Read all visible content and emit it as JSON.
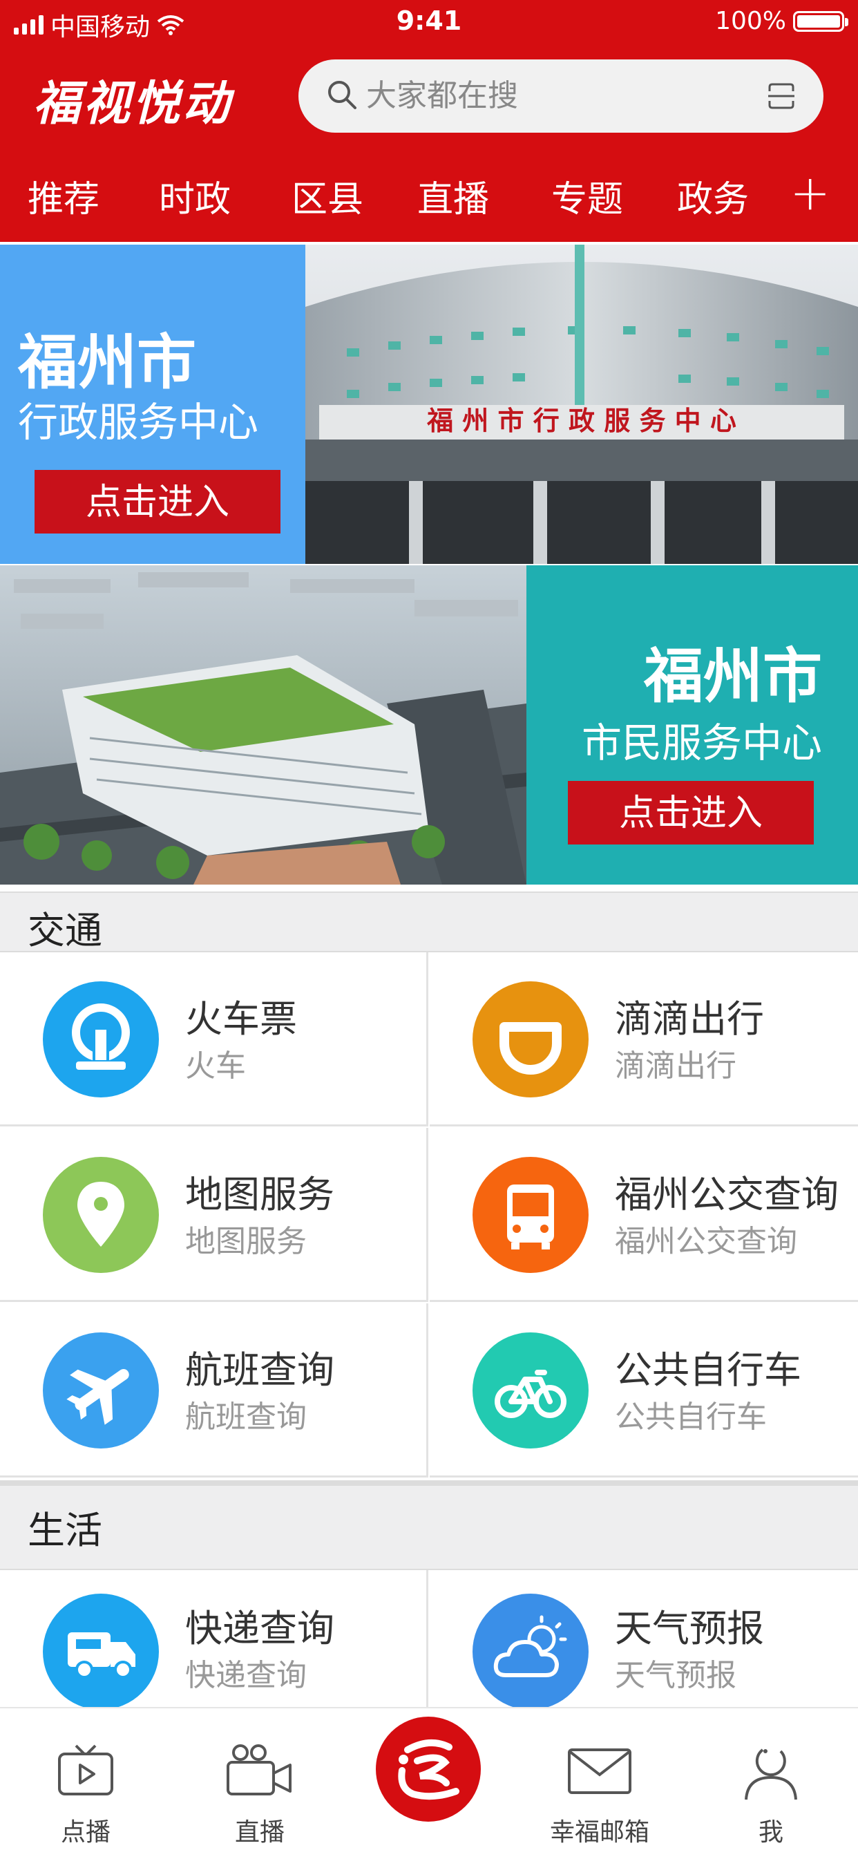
{
  "status_bar": {
    "carrier": "中国移动",
    "time": "9:41",
    "battery": "100%"
  },
  "header": {
    "logo": "福视悦动",
    "search_placeholder": "大家都在搜",
    "tabs": [
      "推荐",
      "时政",
      "区县",
      "直播",
      "专题",
      "政务"
    ],
    "add_tab": "+"
  },
  "banners": [
    {
      "title": "福州市",
      "subtitle": "行政服务中心",
      "button": "点击进入"
    },
    {
      "title": "福州市",
      "subtitle": "市民服务中心",
      "button": "点击进入"
    }
  ],
  "sections": [
    {
      "title": "交通",
      "items": [
        {
          "title": "火车票",
          "subtitle": "火车",
          "icon": "train-icon",
          "color": "#1da5ee"
        },
        {
          "title": "滴滴出行",
          "subtitle": "滴滴出行",
          "icon": "didi-icon",
          "color": "#e7920f"
        },
        {
          "title": "地图服务",
          "subtitle": "地图服务",
          "icon": "map-pin-icon",
          "color": "#8dc758"
        },
        {
          "title": "福州公交查询",
          "subtitle": "福州公交查询",
          "icon": "bus-icon",
          "color": "#f6650f"
        },
        {
          "title": "航班查询",
          "subtitle": "航班查询",
          "icon": "plane-icon",
          "color": "#3aa1ef"
        },
        {
          "title": "公共自行车",
          "subtitle": "公共自行车",
          "icon": "bicycle-icon",
          "color": "#22cab1"
        }
      ]
    },
    {
      "title": "生活",
      "items": [
        {
          "title": "快递查询",
          "subtitle": "快递查询",
          "icon": "delivery-truck-icon",
          "color": "#1da5ee"
        },
        {
          "title": "天气预报",
          "subtitle": "天气预报",
          "icon": "weather-icon",
          "color": "#3a8fe8"
        }
      ]
    }
  ],
  "bottom_nav": [
    {
      "label": "点播",
      "icon": "tv-play-icon"
    },
    {
      "label": "直播",
      "icon": "video-camera-icon"
    },
    {
      "label": "",
      "icon": "app-logo-icon"
    },
    {
      "label": "幸福邮箱",
      "icon": "mail-icon"
    },
    {
      "label": "我",
      "icon": "user-icon"
    }
  ],
  "colors": {
    "brand_red": "#d50d11",
    "banner_blue": "#52a7f3",
    "banner_teal": "#1fafb1",
    "button_red": "#c8111a"
  }
}
